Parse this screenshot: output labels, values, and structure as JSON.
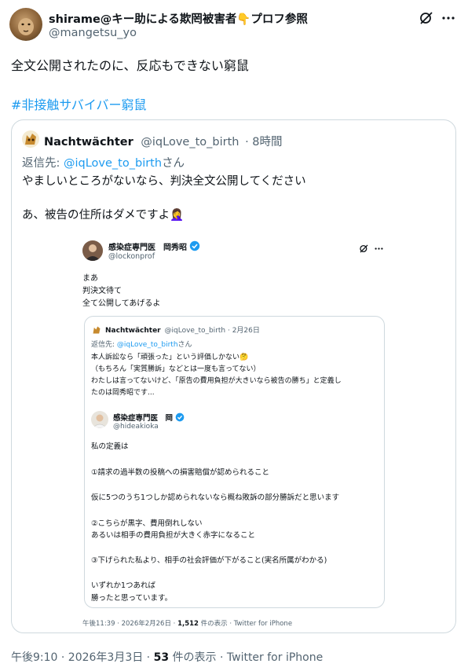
{
  "post": {
    "display_name": "shirame@キー助による欺罔被害者👇プロフ参照",
    "handle": "@mangetsu_yo",
    "body": "全文公開されたのに、反応もできない窮鼠",
    "hashtag": "#非接触サバイバー窮鼠",
    "footer": {
      "time": "午後9:10 · 2026年3月3日 · ",
      "views_count": "53",
      "views_label": " 件の表示 · Twitter for iPhone"
    }
  },
  "quote": {
    "display_name": "Nachtwächter",
    "handle": "@iqLove_to_birth",
    "time": "· 8時間",
    "reply_prefix": "返信先: ",
    "reply_handle": "@iqLove_to_birth",
    "reply_suffix": "さん",
    "line1": "やましいところがないなら、判決全文公開してください",
    "line2": "あ、被告の住所はダメですよ🤦‍♀️"
  },
  "screenshot": {
    "display_name": "感染症専門医　岡秀昭",
    "handle": "@lockonprof",
    "lines": [
      "まあ",
      "判決文待て",
      "全て公開してあげるよ"
    ],
    "nested": {
      "display_name": "Nachtwächter",
      "handle_time": "@iqLove_to_birth · 2月26日",
      "reply_prefix": "返信先: ",
      "reply_handle": "@iqLove_to_birth",
      "reply_suffix": "さん",
      "lines": [
        "本人訴訟なら「頑張った」という評価しかない🤔",
        "（もちろん「実質勝訴」などとは一度も言ってない）",
        "わたしは言ってないけど、「原告の費用負担が大きいなら被告の勝ち」と定義し",
        "たのは岡秀昭です..."
      ],
      "inner": {
        "display_name": "感染症専門医　岡",
        "handle": "@hideakioka",
        "lines": [
          "私の定義は",
          "①請求の過半数の投稿への損害賠償が認められること",
          "仮に5つのうち1つしか認められないなら概ね敗訴の部分勝訴だと思います",
          "②こちらが黒字、費用倒れしない",
          "あるいは相手の費用負担が大きく赤字になること",
          "③下げられた私より、相手の社会評価が下がること(実名所属がわかる)",
          "いずれか1つあれば",
          "勝ったと思っています。"
        ]
      }
    },
    "footer": {
      "time": "午後11:39 · 2026年2月26日 · ",
      "views_count": "1,512",
      "views_label": " 件の表示 · Twitter for iPhone"
    }
  },
  "colors": {
    "link": "#1d9bf0",
    "muted": "#536471",
    "border": "#cfd9de",
    "verified": "#1d9bf0"
  }
}
